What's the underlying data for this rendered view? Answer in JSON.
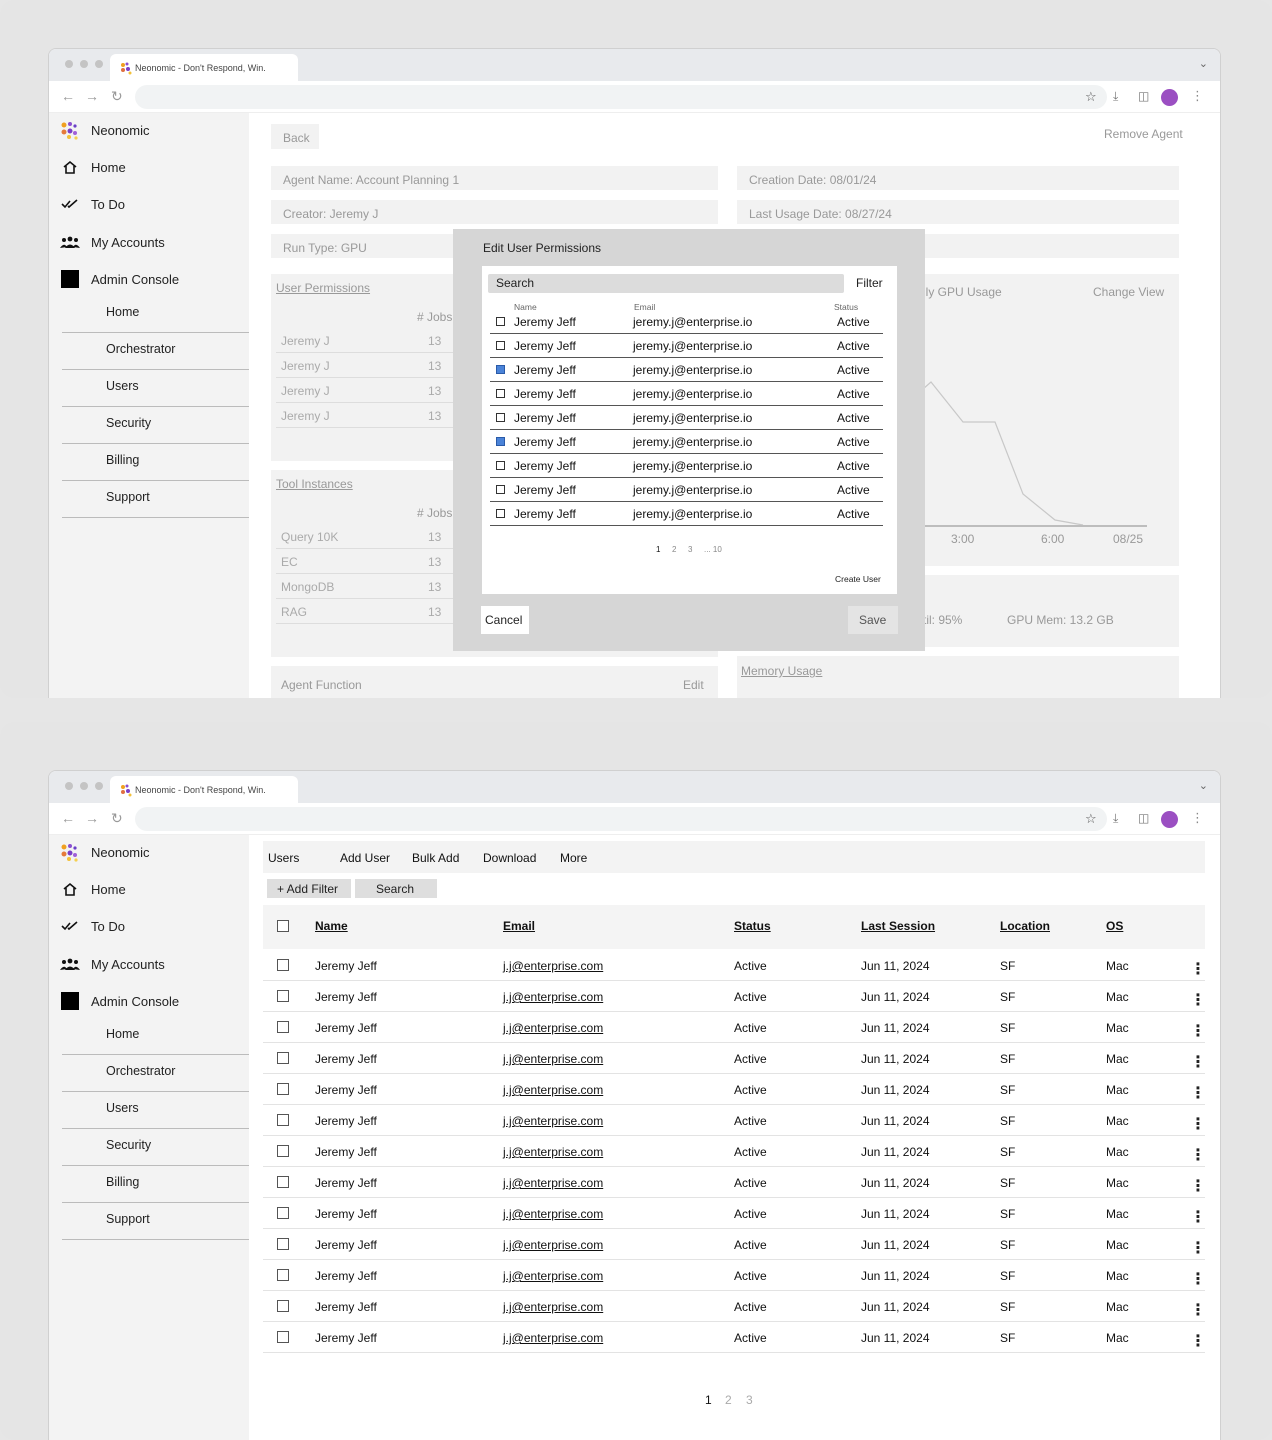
{
  "browser": {
    "tab_title": "Neonomic - Don't Respond, Win."
  },
  "brand": "Neonomic",
  "sidebar": {
    "home": "Home",
    "todo": "To Do",
    "accounts": "My Accounts",
    "admin": "Admin Console",
    "sub": [
      "Home",
      "Orchestrator",
      "Users",
      "Security",
      "Billing",
      "Support"
    ]
  },
  "agent": {
    "back": "Back",
    "remove": "Remove Agent",
    "name": "Agent Name: Account Planning 1",
    "creation": "Creation Date: 08/01/24",
    "creator": "Creator: Jeremy J",
    "last_usage": "Last Usage Date: 08/27/24",
    "run_type": "Run Type: GPU",
    "user_permissions": "User Permissions",
    "jobs_col": "# Jobs",
    "perm_rows": [
      {
        "name": "Jeremy J",
        "jobs": "13"
      },
      {
        "name": "Jeremy J",
        "jobs": "13"
      },
      {
        "name": "Jeremy J",
        "jobs": "13"
      },
      {
        "name": "Jeremy J",
        "jobs": "13"
      }
    ],
    "tool_instances": "Tool Instances",
    "tool_rows": [
      {
        "name": "Query 10K",
        "jobs": "13"
      },
      {
        "name": "EC",
        "jobs": "13"
      },
      {
        "name": "MongoDB",
        "jobs": "13"
      },
      {
        "name": "RAG",
        "jobs": "13"
      }
    ],
    "gpu_title": "ily GPU Usage",
    "change_view": "Change View",
    "gpu_ticks": [
      "3:00",
      "6:00",
      "08/25"
    ],
    "util": "til: 95%",
    "gpu_mem": "GPU Mem: 13.2 GB",
    "memory_usage": "Memory Usage",
    "agent_function": "Agent Function",
    "edit": "Edit"
  },
  "modal": {
    "title": "Edit User Permissions",
    "search": "Search",
    "filter": "Filter",
    "col_name": "Name",
    "col_email": "Email",
    "col_status": "Status",
    "rows": [
      {
        "name": "Jeremy Jeff",
        "email": "jeremy.j@enterprise.io",
        "status": "Active",
        "checked": false
      },
      {
        "name": "Jeremy Jeff",
        "email": "jeremy.j@enterprise.io",
        "status": "Active",
        "checked": false
      },
      {
        "name": "Jeremy Jeff",
        "email": "jeremy.j@enterprise.io",
        "status": "Active",
        "checked": true
      },
      {
        "name": "Jeremy Jeff",
        "email": "jeremy.j@enterprise.io",
        "status": "Active",
        "checked": false
      },
      {
        "name": "Jeremy Jeff",
        "email": "jeremy.j@enterprise.io",
        "status": "Active",
        "checked": false
      },
      {
        "name": "Jeremy Jeff",
        "email": "jeremy.j@enterprise.io",
        "status": "Active",
        "checked": true
      },
      {
        "name": "Jeremy Jeff",
        "email": "jeremy.j@enterprise.io",
        "status": "Active",
        "checked": false
      },
      {
        "name": "Jeremy Jeff",
        "email": "jeremy.j@enterprise.io",
        "status": "Active",
        "checked": false
      },
      {
        "name": "Jeremy Jeff",
        "email": "jeremy.j@enterprise.io",
        "status": "Active",
        "checked": false
      }
    ],
    "pages": [
      "1",
      "2",
      "3",
      "... 10"
    ],
    "create_user": "Create User",
    "cancel": "Cancel",
    "save": "Save"
  },
  "users": {
    "toolbar": [
      "Users",
      "Add User",
      "Bulk Add",
      "Download",
      "More"
    ],
    "add_filter": "+ Add Filter",
    "search": "Search",
    "columns": [
      "Name",
      "Email",
      "Status",
      "Last Session",
      "Location",
      "OS"
    ],
    "row": {
      "name": "Jeremy Jeff",
      "email": "j.j@enterprise.com",
      "status": "Active",
      "last_session": "Jun 11, 2024",
      "location": "SF",
      "os": "Mac"
    },
    "row_count": 13,
    "pages": [
      "1",
      "2",
      "3"
    ]
  },
  "colors": {
    "accent": "#9b4fc2",
    "checked": "#4a83d8"
  }
}
